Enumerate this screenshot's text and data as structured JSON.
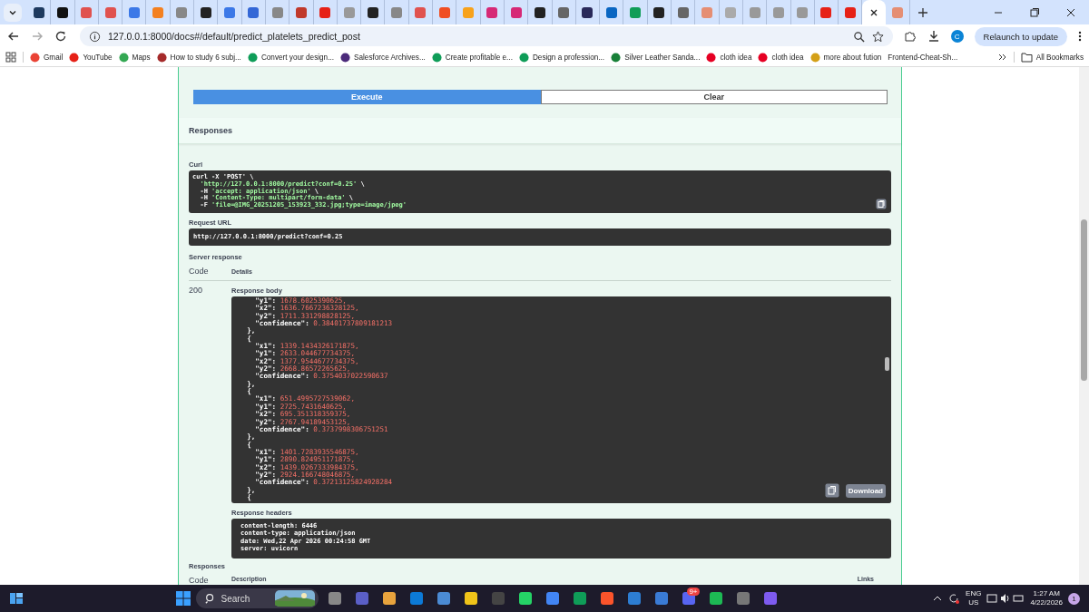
{
  "tabs": [
    {
      "selected": false
    },
    {
      "selected": false
    },
    {
      "selected": false
    },
    {
      "selected": false
    },
    {
      "selected": false
    },
    {
      "selected": false
    },
    {
      "selected": false
    },
    {
      "selected": false
    },
    {
      "selected": false
    },
    {
      "selected": false
    },
    {
      "selected": false
    },
    {
      "selected": false
    },
    {
      "selected": false
    },
    {
      "selected": false
    },
    {
      "selected": false
    },
    {
      "selected": false
    },
    {
      "selected": false
    },
    {
      "selected": false
    },
    {
      "selected": false
    },
    {
      "selected": false
    },
    {
      "selected": false
    },
    {
      "selected": false
    },
    {
      "selected": false
    },
    {
      "selected": false
    },
    {
      "selected": false
    },
    {
      "selected": false
    },
    {
      "selected": false
    },
    {
      "selected": false
    },
    {
      "selected": false
    },
    {
      "selected": false
    },
    {
      "selected": false
    },
    {
      "selected": false
    },
    {
      "selected": false
    },
    {
      "selected": false
    },
    {
      "selected": false
    },
    {
      "selected": true
    },
    {
      "selected": false
    }
  ],
  "address_bar": {
    "url": "127.0.0.1:8000/docs#/default/predict_platelets_predict_post"
  },
  "profile_initial": "C",
  "relaunch_button": "Relaunch to update",
  "bookmarks": [
    "Gmail",
    "YouTube",
    "Maps",
    "How to study 6 subj...",
    "Convert your design...",
    "Salesforce Archives...",
    "Create profitable e...",
    "Design a profession...",
    "Silver Leather Sanda...",
    "cloth idea",
    "cloth idea",
    "more about fution",
    "Frontend-Cheat-Sh..."
  ],
  "all_bookmarks": "All Bookmarks",
  "swagger": {
    "execute_button": "Execute",
    "clear_button": "Clear",
    "responses_title": "Responses",
    "curl_label": "Curl",
    "curl_lines": [
      {
        "flag": "curl -X ",
        "arg": "'POST'",
        "tail": " \\",
        "kind": "plain"
      },
      {
        "arg": "'http://127.0.0.1:8000/predict?conf=0.25'",
        "tail": " \\",
        "kind": "string"
      },
      {
        "flag": "  -H ",
        "arg": "'accept: application/json'",
        "tail": " \\",
        "kind": "string"
      },
      {
        "flag": "  -H ",
        "arg": "'Content-Type: multipart/form-data'",
        "tail": " \\",
        "kind": "string"
      },
      {
        "flag": "  -F ",
        "arg": "'file=@IMG_20251205_153923_332.jpg;type=image/jpeg'",
        "kind": "string"
      }
    ],
    "request_url_label": "Request URL",
    "request_url": "http://127.0.0.1:8000/predict?conf=0.25",
    "server_response_label": "Server response",
    "columns": [
      "Code",
      "Details"
    ],
    "status_code": "200",
    "response_body_label": "Response body",
    "response_body_lines": [
      {
        "key": "    \"y1\": ",
        "value": "1678.6025390625,"
      },
      {
        "key": "    \"x2\": ",
        "value": "1636.7667236328125,"
      },
      {
        "key": "    \"y2\": ",
        "value": "1711.331298828125,"
      },
      {
        "key": "    \"confidence\": ",
        "value": "0.38401737809181213"
      },
      {
        "key": "  },"
      },
      {
        "key": "  {"
      },
      {
        "key": "    \"x1\": ",
        "value": "1339.1434326171875,"
      },
      {
        "key": "    \"y1\": ",
        "value": "2633.044677734375,"
      },
      {
        "key": "    \"x2\": ",
        "value": "1377.9544677734375,"
      },
      {
        "key": "    \"y2\": ",
        "value": "2668.86572265625,"
      },
      {
        "key": "    \"confidence\": ",
        "value": "0.3754037022590637"
      },
      {
        "key": "  },"
      },
      {
        "key": "  {"
      },
      {
        "key": "    \"x1\": ",
        "value": "651.4995727539062,"
      },
      {
        "key": "    \"y1\": ",
        "value": "2725.7431640625,"
      },
      {
        "key": "    \"x2\": ",
        "value": "695.351318359375,"
      },
      {
        "key": "    \"y2\": ",
        "value": "2767.94189453125,"
      },
      {
        "key": "    \"confidence\": ",
        "value": "0.3737998306751251"
      },
      {
        "key": "  },"
      },
      {
        "key": "  {"
      },
      {
        "key": "    \"x1\": ",
        "value": "1401.7283935546875,"
      },
      {
        "key": "    \"y1\": ",
        "value": "2890.824951171875,"
      },
      {
        "key": "    \"x2\": ",
        "value": "1439.0267333984375,"
      },
      {
        "key": "    \"y2\": ",
        "value": "2924.166748046875,"
      },
      {
        "key": "    \"confidence\": ",
        "value": "0.37213125824928284"
      },
      {
        "key": "  },"
      },
      {
        "key": "  {"
      }
    ],
    "download_button": "Download",
    "response_headers_label": "Response headers",
    "response_headers": [
      "content-length: 6446",
      "content-type: application/json",
      "date: Wed,22 Apr 2026 00:24:58 GMT",
      "server: uvicorn"
    ],
    "responses_label": "Responses",
    "responses_columns": [
      "Code",
      "Description",
      "Links"
    ]
  },
  "taskbar": {
    "search_placeholder": "Search",
    "discord_badge": "9+",
    "language": "ENG",
    "region": "US",
    "time": "1:27 AM",
    "date": "4/22/2026",
    "notification_count": "1"
  }
}
